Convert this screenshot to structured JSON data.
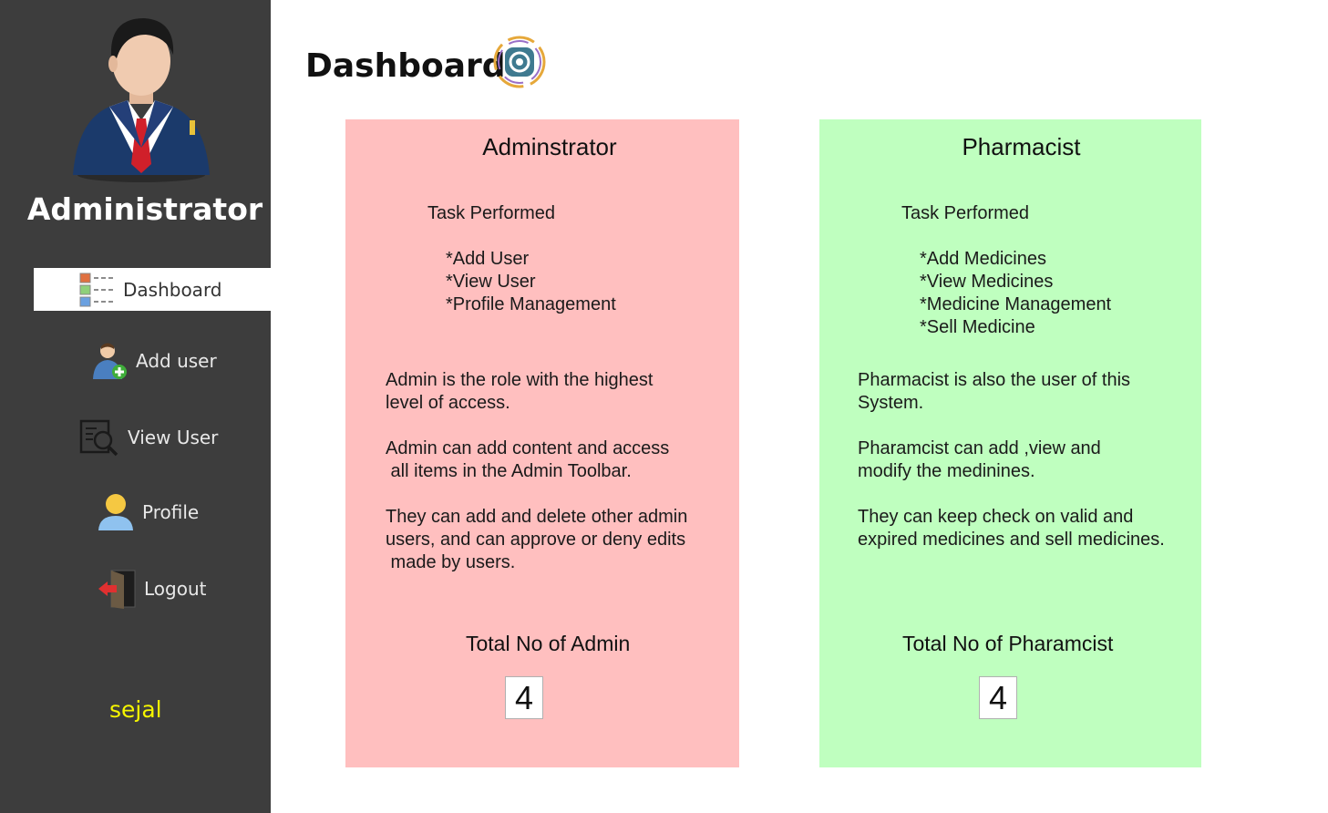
{
  "sidebar": {
    "role_title": "Administrator",
    "username": "sejal",
    "items": [
      {
        "label": "Dashboard",
        "icon": "dashboard-list-icon",
        "active": true
      },
      {
        "label": "Add user",
        "icon": "add-user-icon"
      },
      {
        "label": "View User",
        "icon": "view-user-icon"
      },
      {
        "label": "Profile",
        "icon": "profile-icon"
      },
      {
        "label": "Logout",
        "icon": "logout-icon"
      }
    ]
  },
  "header": {
    "title": "Dashboard",
    "icon": "dashboard-refresh-icon"
  },
  "admin_card": {
    "title": "Adminstrator",
    "task_heading": "Task Performed",
    "tasks": [
      "*Add User",
      "*View User",
      "*Profile Management"
    ],
    "desc1_line1": "Admin is the role with the highest",
    "desc1_line2": "level of access.",
    "desc2_line1": "Admin can add content and access",
    "desc2_line2": " all items in the Admin Toolbar.",
    "desc3_line1": "They can add and delete other admin",
    "desc3_line2": "users, and can approve or deny edits",
    "desc3_line3": " made by users.",
    "total_label": "Total No of Admin",
    "total_value": "4"
  },
  "pharmacist_card": {
    "title": "Pharmacist",
    "task_heading": "Task Performed",
    "tasks": [
      "*Add Medicines",
      "*View Medicines",
      "*Medicine Management",
      "*Sell Medicine"
    ],
    "desc1_line1": "Pharmacist is also the user of this",
    "desc1_line2": "System.",
    "desc2_line1": "Pharamcist can add ,view and",
    "desc2_line2": "modify the medinines.",
    "desc3_line1": "They can keep check on valid and",
    "desc3_line2": "expired medicines and sell medicines.",
    "total_label": "Total No of Pharamcist",
    "total_value": "4"
  },
  "colors": {
    "sidebar_bg": "#3d3d3d",
    "admin_card_bg": "#ffbfbf",
    "pharmacist_card_bg": "#bfffbf",
    "username_color": "#f5f500"
  }
}
